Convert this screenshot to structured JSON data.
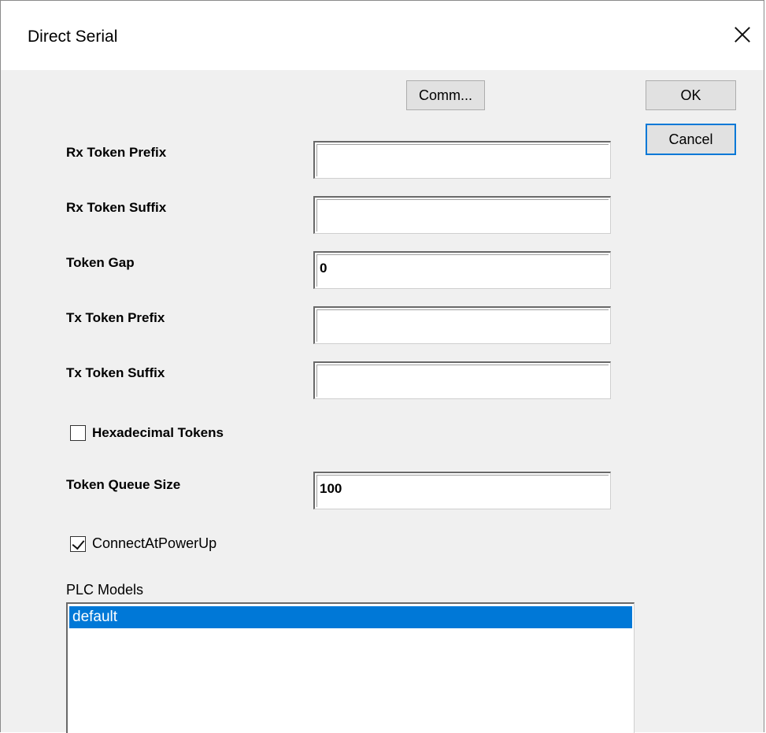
{
  "window": {
    "title": "Direct Serial"
  },
  "buttons": {
    "comm": "Comm...",
    "ok": "OK",
    "cancel": "Cancel"
  },
  "fields": [
    {
      "label": "Rx Token Prefix",
      "value": ""
    },
    {
      "label": "Rx Token Suffix",
      "value": ""
    },
    {
      "label": "Token Gap",
      "value": "0"
    },
    {
      "label": "Tx Token Prefix",
      "value": ""
    },
    {
      "label": "Tx Token Suffix",
      "value": ""
    }
  ],
  "hex_checkbox": {
    "label": "Hexadecimal Tokens",
    "checked": false
  },
  "queue": {
    "label": "Token Queue Size",
    "value": "100"
  },
  "connect_checkbox": {
    "label": "ConnectAtPowerUp",
    "checked": true
  },
  "plc_models": {
    "label": "PLC Models",
    "items": [
      "default"
    ],
    "selected": "default"
  },
  "colors": {
    "accent": "#0078d7",
    "dialog_bg": "#f0f0f0",
    "button_bg": "#e1e1e1"
  }
}
